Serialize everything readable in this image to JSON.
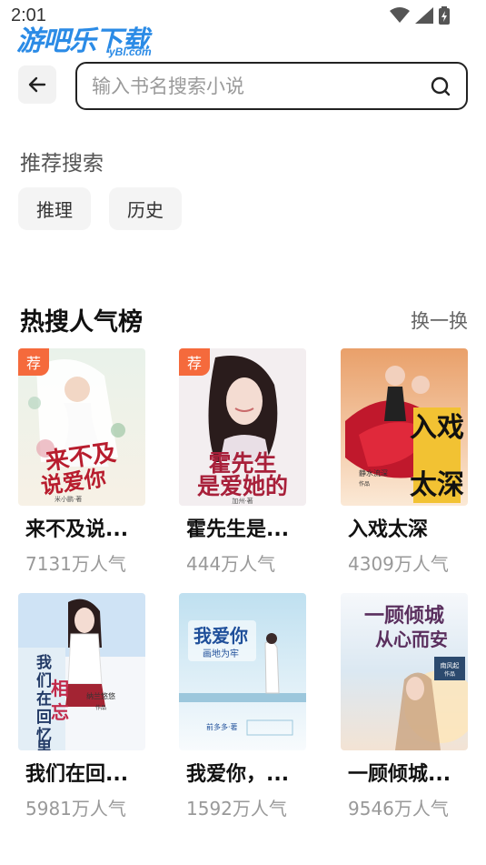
{
  "status_bar": {
    "time": "2:01"
  },
  "watermark": {
    "main": "游吧乐下载",
    "sub": "yBl.com"
  },
  "search": {
    "placeholder": "输入书名搜索小说"
  },
  "recommended": {
    "title": "推荐搜索",
    "tags": [
      "推理",
      "历史"
    ]
  },
  "hot": {
    "title": "热搜人气榜",
    "refresh_label": "换一换",
    "badge_label": "荐",
    "books": [
      {
        "title": "来不及说...",
        "popularity": "7131万人气",
        "badge": true,
        "cover_title": "来不及说爱你",
        "cover_author": "米小鹏·著"
      },
      {
        "title": "霍先生是...",
        "popularity": "444万人气",
        "badge": true,
        "cover_title": "霍先生是爱她的",
        "cover_author": "加州·著"
      },
      {
        "title": "入戏太深",
        "popularity": "4309万人气",
        "badge": false,
        "cover_title": "入戏太深",
        "cover_author": "静水流深 作品"
      },
      {
        "title": "我们在回...",
        "popularity": "5981万人气",
        "badge": false,
        "cover_title": "我们在回忆里相忘",
        "cover_author": "纳兰悠悠 作品"
      },
      {
        "title": "我爱你，...",
        "popularity": "1592万人气",
        "badge": false,
        "cover_title": "我爱你 画地为牢",
        "cover_author": "前多多·著"
      },
      {
        "title": "一顾倾城...",
        "popularity": "9546万人气",
        "badge": false,
        "cover_title": "一顾倾城从心而安",
        "cover_author": "南风起 作品"
      }
    ]
  }
}
